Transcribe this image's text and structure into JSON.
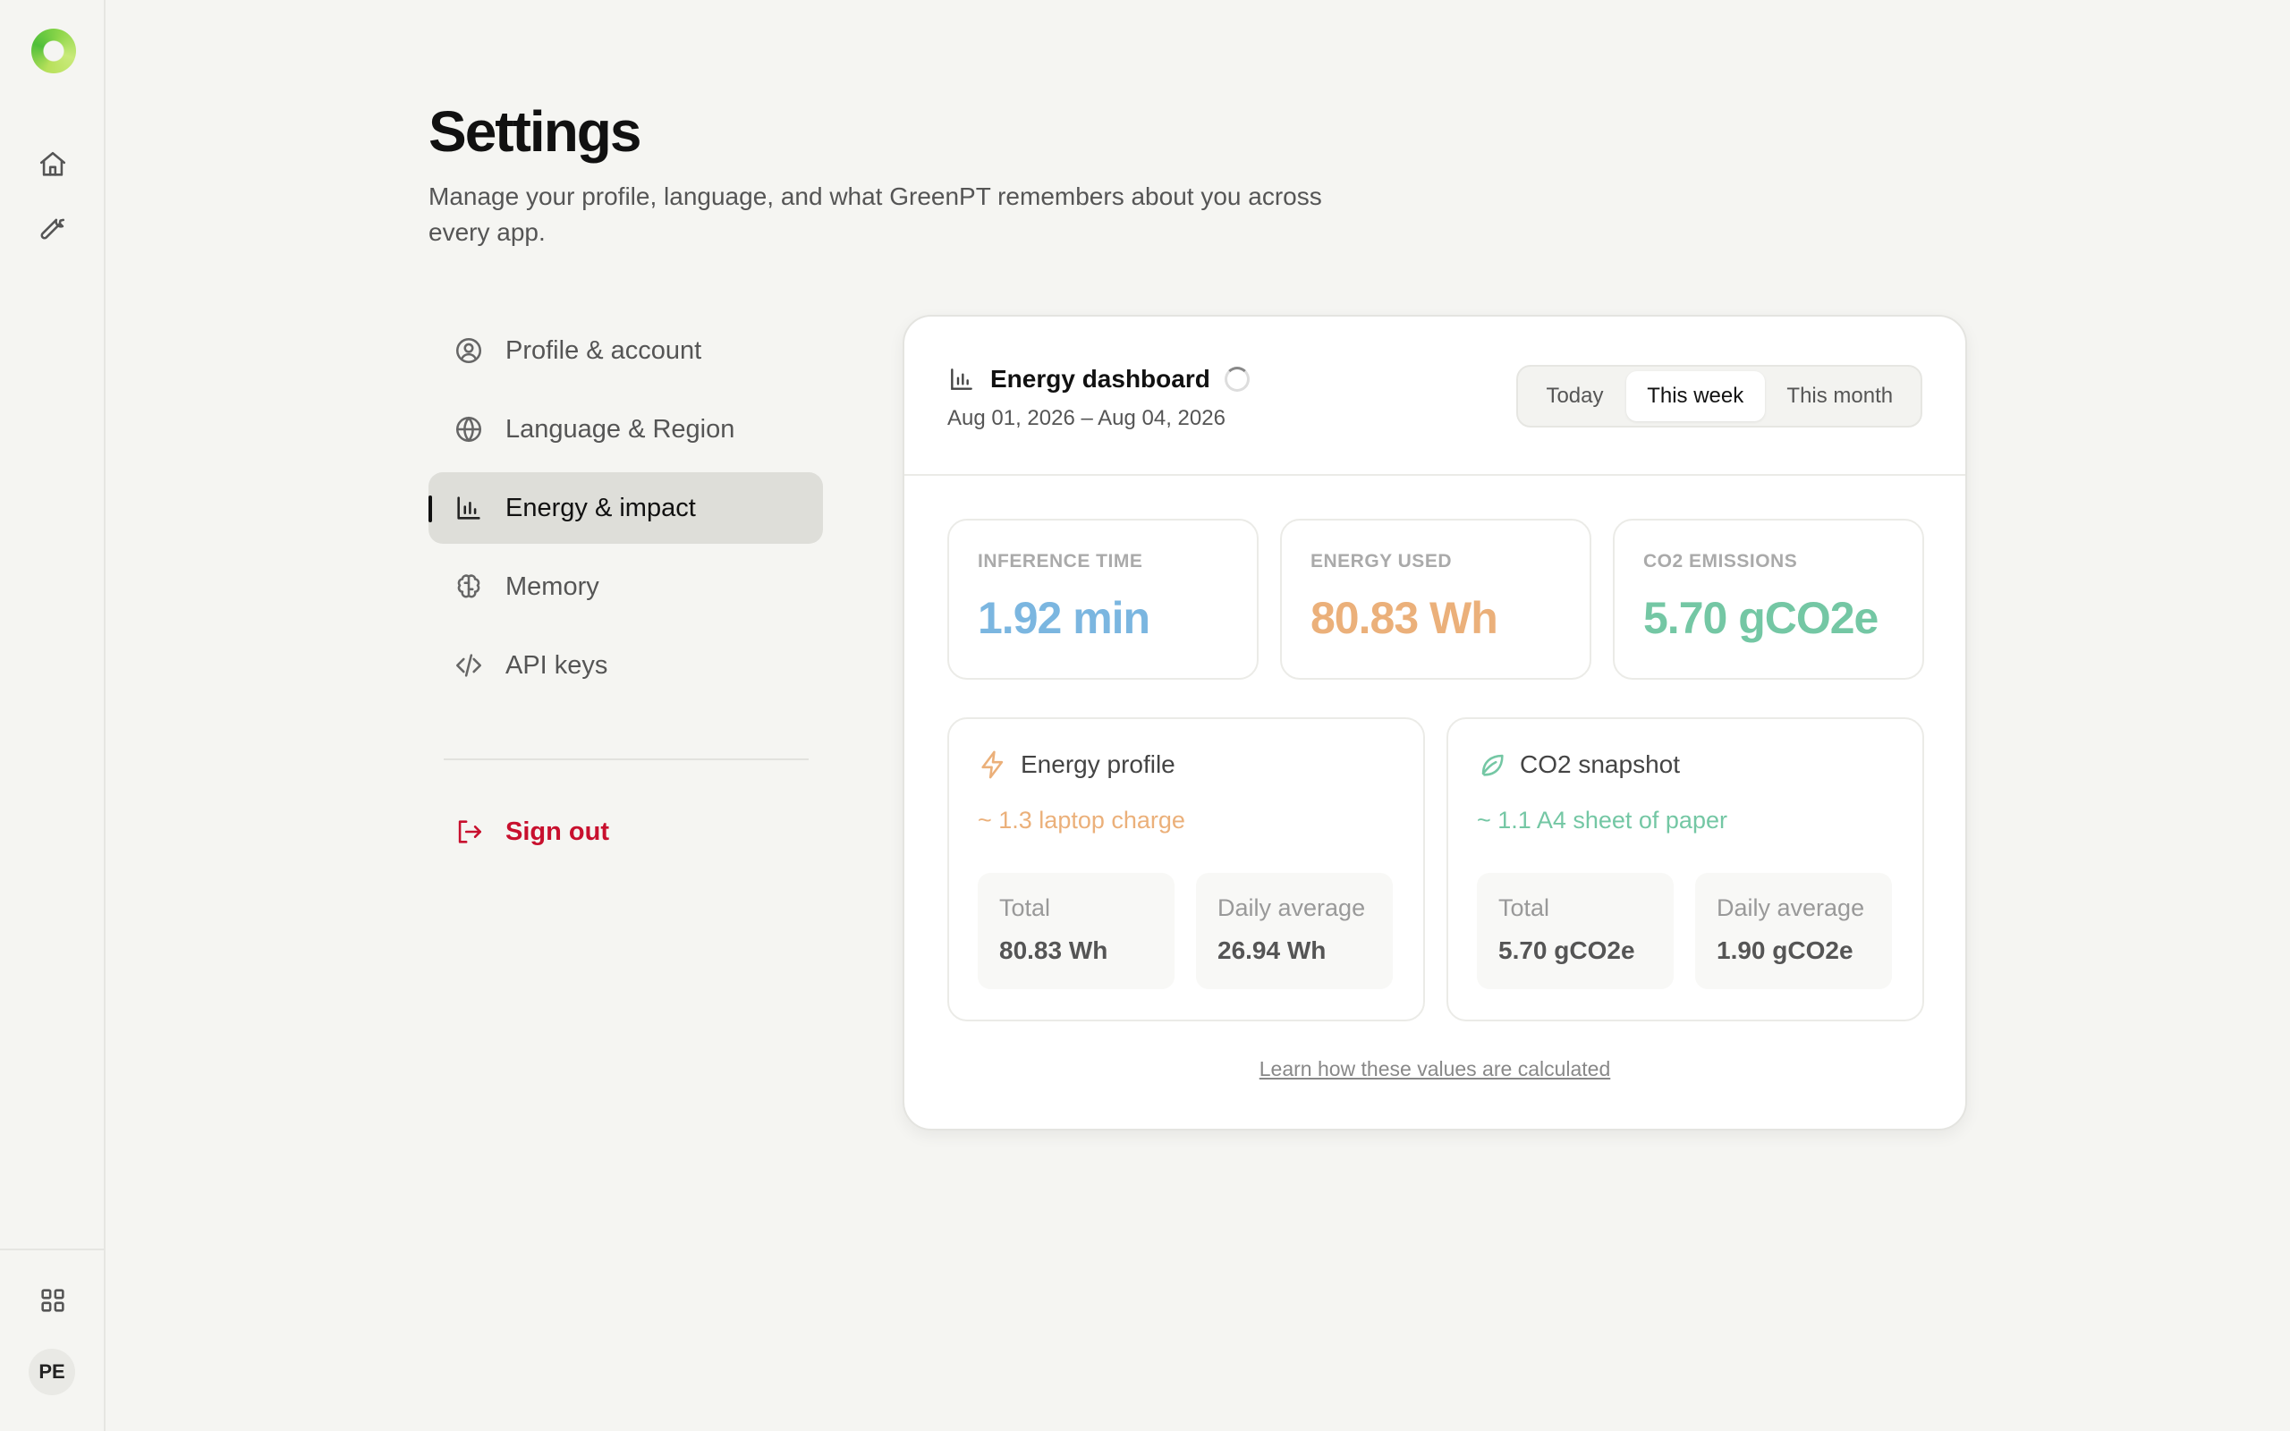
{
  "header": {
    "title": "Settings",
    "subtitle": "Manage your profile, language, and what GreenPT remembers about you across every app."
  },
  "rail": {
    "avatar_initials": "PE"
  },
  "nav": {
    "items": [
      {
        "label": "Profile & account",
        "icon": "user-circle-icon"
      },
      {
        "label": "Language & Region",
        "icon": "globe-icon"
      },
      {
        "label": "Energy & impact",
        "icon": "bar-chart-icon",
        "active": true
      },
      {
        "label": "Memory",
        "icon": "brain-icon"
      },
      {
        "label": "API keys",
        "icon": "code-icon"
      }
    ],
    "signout": "Sign out"
  },
  "dashboard": {
    "title": "Energy dashboard",
    "date_range": "Aug 01, 2026 – Aug 04, 2026",
    "periods": [
      "Today",
      "This week",
      "This month"
    ],
    "selected_period": "This week",
    "stats": [
      {
        "label": "INFERENCE TIME",
        "value": "1.92 min",
        "color": "#7bb6e0"
      },
      {
        "label": "ENERGY USED",
        "value": "80.83 Wh",
        "color": "#ebb07a"
      },
      {
        "label": "CO2 EMISSIONS",
        "value": "5.70 gCO2e",
        "color": "#74c7a4"
      }
    ],
    "energy_profile": {
      "title": "Energy profile",
      "equivalent": "~ 1.3 laptop charge",
      "color": "#ebb07a",
      "total_label": "Total",
      "total_value": "80.83 Wh",
      "avg_label": "Daily average",
      "avg_value": "26.94 Wh"
    },
    "co2_snapshot": {
      "title": "CO2 snapshot",
      "equivalent": "~ 1.1 A4 sheet of paper",
      "color": "#74c7a4",
      "total_label": "Total",
      "total_value": "5.70 gCO2e",
      "avg_label": "Daily average",
      "avg_value": "1.90 gCO2e"
    },
    "learn_link": "Learn how these values are calculated"
  }
}
